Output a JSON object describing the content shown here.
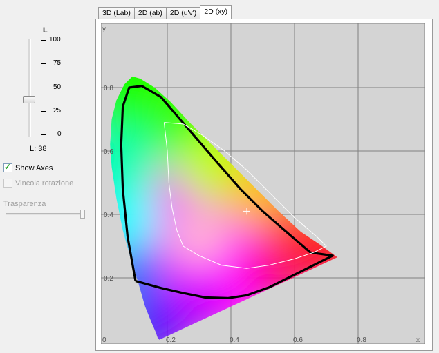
{
  "lightness_slider": {
    "title": "L",
    "ticks": [
      "100",
      "75",
      "50",
      "25",
      "0"
    ],
    "value_label": "L: 38",
    "value": 38,
    "max": 100
  },
  "options": {
    "show_axes_label": "Show Axes",
    "show_axes_checked": true,
    "vincola_label": "Vincola rotazione",
    "vincola_checked": false
  },
  "transparency": {
    "label": "Trasparenza",
    "value_fraction": 0.98
  },
  "tabs": [
    {
      "label": "3D (Lab)",
      "active": false
    },
    {
      "label": "2D (ab)",
      "active": false
    },
    {
      "label": "2D (u'v')",
      "active": false
    },
    {
      "label": "2D (xy)",
      "active": true
    }
  ],
  "chart_data": {
    "type": "scatter",
    "subtype": "CIE 1931 xy chromaticity diagram",
    "x_axis_label": "x",
    "y_axis_label": "y",
    "xlim": [
      0,
      0.9
    ],
    "ylim": [
      0,
      0.9
    ],
    "x_tick_labels": [
      "0",
      "0.2",
      "0.4",
      "0.6",
      "0.8"
    ],
    "y_tick_labels": [
      "0.2",
      "0.4",
      "0.6",
      "0.8"
    ],
    "grid": true,
    "background_color": "#d4d4d4",
    "spectral_locus": [
      [
        0.175,
        0.005
      ],
      [
        0.17,
        0.01
      ],
      [
        0.163,
        0.03
      ],
      [
        0.15,
        0.06
      ],
      [
        0.13,
        0.11
      ],
      [
        0.11,
        0.18
      ],
      [
        0.085,
        0.26
      ],
      [
        0.06,
        0.35
      ],
      [
        0.04,
        0.45
      ],
      [
        0.025,
        0.55
      ],
      [
        0.02,
        0.62
      ],
      [
        0.025,
        0.7
      ],
      [
        0.04,
        0.76
      ],
      [
        0.065,
        0.81
      ],
      [
        0.09,
        0.835
      ],
      [
        0.115,
        0.828
      ],
      [
        0.16,
        0.8
      ],
      [
        0.21,
        0.755
      ],
      [
        0.27,
        0.69
      ],
      [
        0.34,
        0.62
      ],
      [
        0.41,
        0.55
      ],
      [
        0.48,
        0.48
      ],
      [
        0.55,
        0.41
      ],
      [
        0.62,
        0.345
      ],
      [
        0.68,
        0.305
      ],
      [
        0.735,
        0.265
      ]
    ],
    "black_gamut_outline": [
      [
        0.1,
        0.19
      ],
      [
        0.075,
        0.33
      ],
      [
        0.06,
        0.48
      ],
      [
        0.055,
        0.62
      ],
      [
        0.06,
        0.74
      ],
      [
        0.08,
        0.8
      ],
      [
        0.12,
        0.805
      ],
      [
        0.18,
        0.77
      ],
      [
        0.24,
        0.7
      ],
      [
        0.3,
        0.63
      ],
      [
        0.36,
        0.56
      ],
      [
        0.43,
        0.48
      ],
      [
        0.5,
        0.41
      ],
      [
        0.58,
        0.34
      ],
      [
        0.65,
        0.28
      ],
      [
        0.72,
        0.27
      ],
      [
        0.62,
        0.22
      ],
      [
        0.52,
        0.17
      ],
      [
        0.45,
        0.145
      ],
      [
        0.39,
        0.136
      ],
      [
        0.32,
        0.138
      ],
      [
        0.25,
        0.152
      ],
      [
        0.18,
        0.168
      ],
      [
        0.1,
        0.19
      ]
    ],
    "white_gamut_outline": [
      [
        0.19,
        0.69
      ],
      [
        0.2,
        0.6
      ],
      [
        0.205,
        0.5
      ],
      [
        0.215,
        0.42
      ],
      [
        0.23,
        0.35
      ],
      [
        0.25,
        0.3
      ],
      [
        0.3,
        0.27
      ],
      [
        0.37,
        0.24
      ],
      [
        0.45,
        0.23
      ],
      [
        0.52,
        0.24
      ],
      [
        0.6,
        0.26
      ],
      [
        0.66,
        0.28
      ],
      [
        0.7,
        0.3
      ],
      [
        0.67,
        0.33
      ],
      [
        0.6,
        0.39
      ],
      [
        0.52,
        0.47
      ],
      [
        0.45,
        0.54
      ],
      [
        0.38,
        0.6
      ],
      [
        0.31,
        0.65
      ],
      [
        0.25,
        0.685
      ],
      [
        0.19,
        0.69
      ]
    ],
    "white_point": [
      0.45,
      0.41
    ]
  }
}
